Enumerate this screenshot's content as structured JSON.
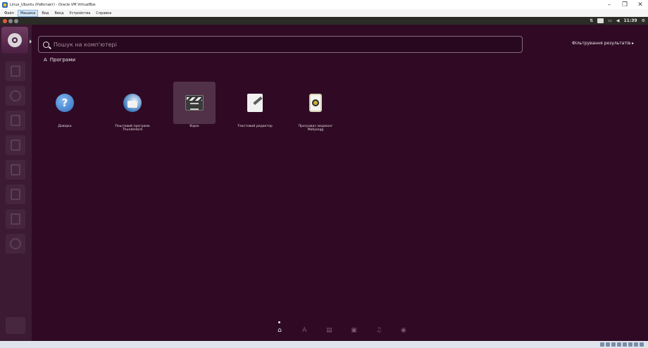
{
  "host": {
    "title": "Linux_Ubuntu (Работает) - Oracle VM VirtualBox",
    "menu": [
      "Файл",
      "Машина",
      "Вид",
      "Ввод",
      "Устройства",
      "Справка"
    ],
    "controls": {
      "minimize": "–",
      "maximize": "❐",
      "close": "✕"
    }
  },
  "panel": {
    "indicators": {
      "keyboard": "⇅",
      "mail": "",
      "battery": "▭",
      "sound": "◀",
      "time": "11:39",
      "session": "⚙"
    }
  },
  "dash": {
    "search_placeholder": "Пошук на комп'ютері",
    "filter_label": "Фільтрування результатів ▸",
    "category_label": "Програми",
    "apps": [
      {
        "label": "Довідка",
        "icon": "help-icon"
      },
      {
        "label": "Поштовий програма Thunderbird",
        "icon": "thunderbird-icon"
      },
      {
        "label": "Відео",
        "icon": "videos-icon"
      },
      {
        "label": "Текстовий редактор",
        "icon": "text-editor-icon"
      },
      {
        "label": "Програвач маджонг Mahjongg",
        "icon": "mahjongg-icon"
      }
    ],
    "lenses": [
      "home-lens",
      "applications-lens",
      "files-lens",
      "video-lens",
      "music-lens",
      "photos-lens"
    ]
  },
  "colors": {
    "background": "#300a24",
    "launcher": "#3c1a33",
    "top_panel": "#2b2b27"
  }
}
